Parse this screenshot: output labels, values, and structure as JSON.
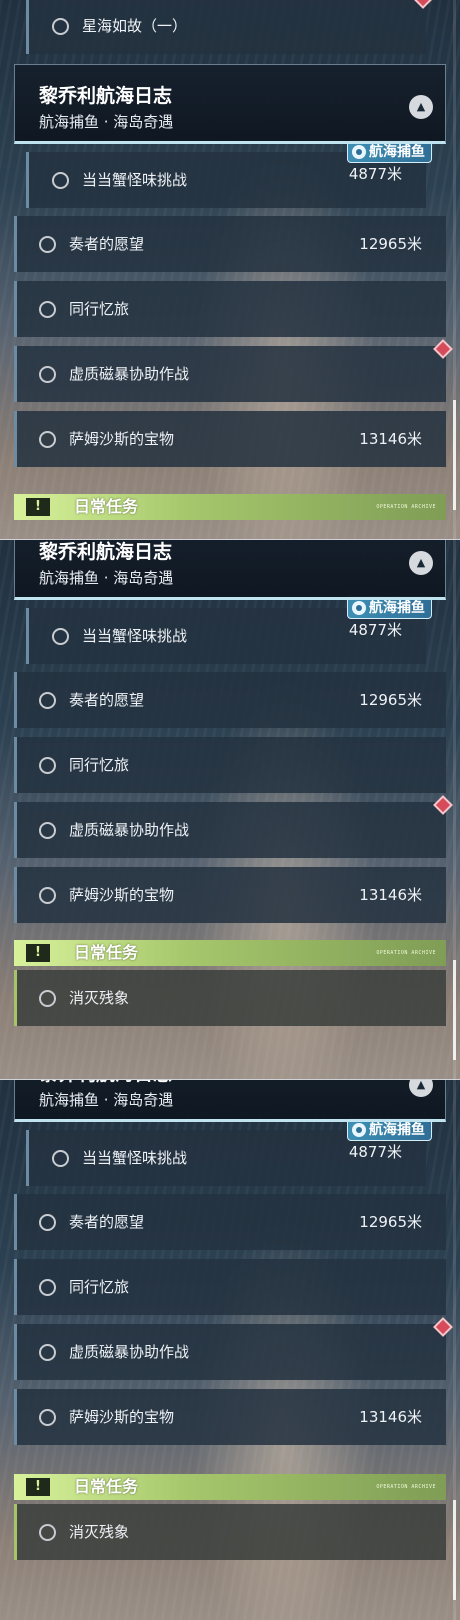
{
  "quest_group": {
    "title": "黎乔利航海日志",
    "subtitle": "航海捕鱼 · 海岛奇遇",
    "collapse_icon": "chevron-up-icon"
  },
  "prev_quest": {
    "label": "星海如故（一）"
  },
  "quests": [
    {
      "label": "当当蟹怪味挑战",
      "distance": "4877米",
      "tag": "航海捕鱼"
    },
    {
      "label": "奏者的愿望",
      "distance": "12965米"
    },
    {
      "label": "同行忆旅",
      "distance": ""
    },
    {
      "label": "虚质磁暴协助作战",
      "distance": "",
      "flag": "red-diamond-icon"
    },
    {
      "label": "萨姆沙斯的宝物",
      "distance": "13146米"
    }
  ],
  "daily": {
    "title": "日常任务",
    "icon": "exclamation-icon",
    "watermark": "OPERATION ARCHIVE",
    "items": [
      {
        "label": "消灭残象"
      }
    ]
  },
  "colors": {
    "accent_green": "#a6c76c",
    "accent_blue": "#3e8fb5",
    "alert_red": "#d64a5a"
  }
}
